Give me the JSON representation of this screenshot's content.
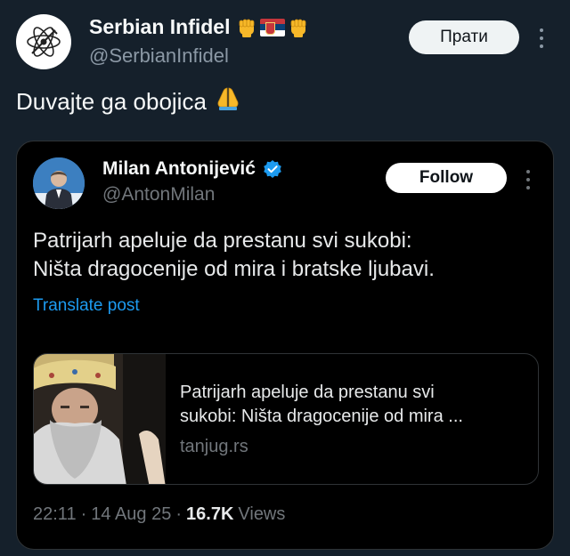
{
  "outer_tweet": {
    "author_name": "Serbian Infidel",
    "author_handle": "@SerbianInfidel",
    "follow_label": "Прати",
    "text": "Duvajte ga obojica",
    "name_badges": [
      "fist-emoji",
      "serbian-flag-emoji",
      "fist-emoji"
    ],
    "text_emoji": "folded-hands-emoji"
  },
  "quoted_tweet": {
    "author_name": "Milan Antonijević",
    "author_handle": "@AntonMilan",
    "follow_label": "Follow",
    "text_lines": [
      "Patrijarh apeluje da prestanu svi sukobi:",
      "Ništa dragocenije od mira i bratske ljubavi."
    ],
    "translate_label": "Translate post",
    "link_card": {
      "headline_lines": [
        "Patrijarh apeluje da prestanu svi",
        "sukobi: Ništa dragocenije od mira ..."
      ],
      "domain": "tanjug.rs"
    },
    "meta": {
      "time": "22:11",
      "date": "14 Aug 25",
      "views_count": "16.7K",
      "views_label": "Views",
      "separator": "·"
    }
  },
  "colors": {
    "background": "#15202b",
    "card_background": "#000000",
    "link_blue": "#1d9bf0",
    "verified_blue": "#1d9bf0",
    "muted_text": "#71767b"
  }
}
